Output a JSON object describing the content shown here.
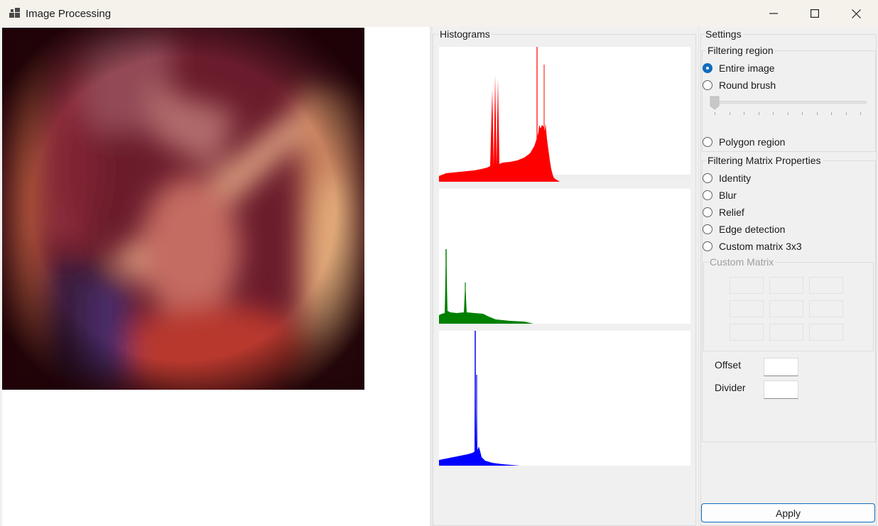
{
  "window": {
    "title": "Image Processing"
  },
  "histograms": {
    "title": "Histograms",
    "colors": {
      "red": "#ff0000",
      "green": "#008000",
      "blue": "#0000ff"
    }
  },
  "settings": {
    "title": "Settings",
    "filtering_region": {
      "title": "Filtering region",
      "options": [
        {
          "label": "Entire image",
          "checked": true
        },
        {
          "label": "Round brush",
          "checked": false
        },
        {
          "label": "Polygon region",
          "checked": false
        }
      ]
    },
    "matrix_properties": {
      "title": "Filtering Matrix Properties",
      "options": [
        {
          "label": "Identity",
          "checked": false
        },
        {
          "label": "Blur",
          "checked": false
        },
        {
          "label": "Relief",
          "checked": false
        },
        {
          "label": "Edge detection",
          "checked": false
        },
        {
          "label": "Custom matrix 3x3",
          "checked": false
        }
      ]
    },
    "custom_matrix": {
      "title": "Custom Matrix"
    },
    "offset": {
      "label": "Offset",
      "value": ""
    },
    "divider": {
      "label": "Divider",
      "value": ""
    },
    "apply_label": "Apply"
  },
  "accent_color": "#0f6cbd"
}
